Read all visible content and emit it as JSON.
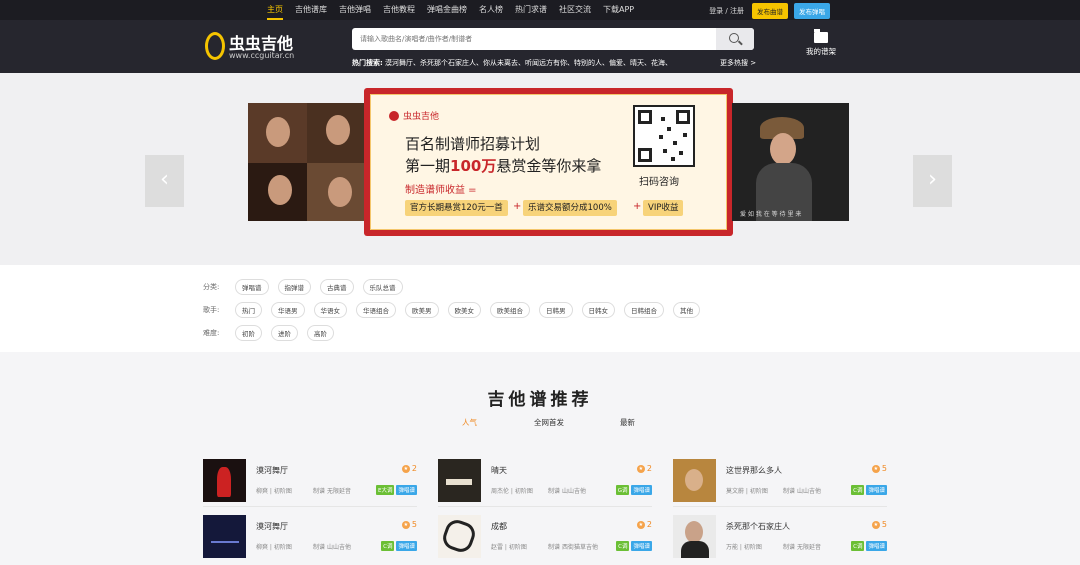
{
  "topnav": {
    "items": [
      "主页",
      "吉他谱库",
      "吉他弹唱",
      "吉他教程",
      "弹唱金曲榜",
      "名人榜",
      "热门求谱",
      "社区交流",
      "下载APP"
    ],
    "login": "登录 / 注册",
    "publish_song": "发布曲谱",
    "publish_request": "发布弹唱",
    "accent": "#f5c400"
  },
  "header": {
    "logo_cn": "虫虫吉他",
    "logo_en": "www.ccguitar.cn",
    "search_placeholder": "请输入歌曲名/演唱者/曲作者/制谱者",
    "hot_label": "热门搜索:",
    "hot_terms": "漠河舞厅、杀死那个石家庄人、你从未离去、听闻远方有你、特别的人、偏爱、晴天、花海、",
    "more_hot": "更多热搜 >",
    "my_lib": "我的谱架"
  },
  "banner": {
    "brand": "虫虫吉他",
    "line1": "百名制谱师招募计划",
    "line2_pre": "第一期",
    "line2_em": "100万",
    "line2_post": "悬赏金等你来拿",
    "income": "制造谱师收益 =",
    "pill_a": "官方长期悬赏120元一首",
    "pill_b": "乐谱交易额分成100%",
    "pill_c": "VIP收益",
    "plus": "+",
    "scan": "扫码咨询",
    "right_caption": "爱 如 我 在 等 待 里 来",
    "prev": "‹",
    "next": "›"
  },
  "filters": {
    "cat_label": "分类:",
    "cat": [
      "弹唱谱",
      "指弹谱",
      "古典谱",
      "乐队总谱"
    ],
    "singer_label": "歌手:",
    "singer": [
      "热门",
      "华语男",
      "华语女",
      "华语组合",
      "欧美男",
      "欧美女",
      "欧美组合",
      "日韩男",
      "日韩女",
      "日韩组合",
      "其他"
    ],
    "level_label": "难度:",
    "level": [
      "初阶",
      "进阶",
      "高阶"
    ]
  },
  "rec": {
    "title": "吉他谱推荐",
    "tabs": [
      "人气",
      "全网首发",
      "最新"
    ],
    "cards": [
      {
        "name": "漠河舞厅",
        "meta": "柳爽 | 初阶图",
        "maker_label": "制谱",
        "maker": "无限延音",
        "rank": "2",
        "tags": [
          "E大调",
          "弹唱谱"
        ]
      },
      {
        "name": "晴天",
        "meta": "周杰伦 | 初阶图",
        "maker_label": "制谱",
        "maker": "山山吉他",
        "rank": "2",
        "tags": [
          "G调",
          "弹唱谱"
        ]
      },
      {
        "name": "这世界那么多人",
        "meta": "莫文蔚 | 初阶图",
        "maker_label": "制谱",
        "maker": "山山吉他",
        "rank": "5",
        "tags": [
          "C调",
          "弹唱谱"
        ]
      },
      {
        "name": "漠河舞厅",
        "meta": "柳爽 | 初阶图",
        "maker_label": "制谱",
        "maker": "山山吉他",
        "rank": "5",
        "tags": [
          "C调",
          "弹唱谱"
        ]
      },
      {
        "name": "成都",
        "meta": "赵雷 | 初阶图",
        "maker_label": "制谱",
        "maker": "西街猫草吉他",
        "rank": "2",
        "tags": [
          "C调",
          "弹唱谱"
        ]
      },
      {
        "name": "杀死那个石家庄人",
        "meta": "万能 | 初阶图",
        "maker_label": "制谱",
        "maker": "无限延音",
        "rank": "5",
        "tags": [
          "C调",
          "弹唱谱"
        ]
      }
    ]
  }
}
